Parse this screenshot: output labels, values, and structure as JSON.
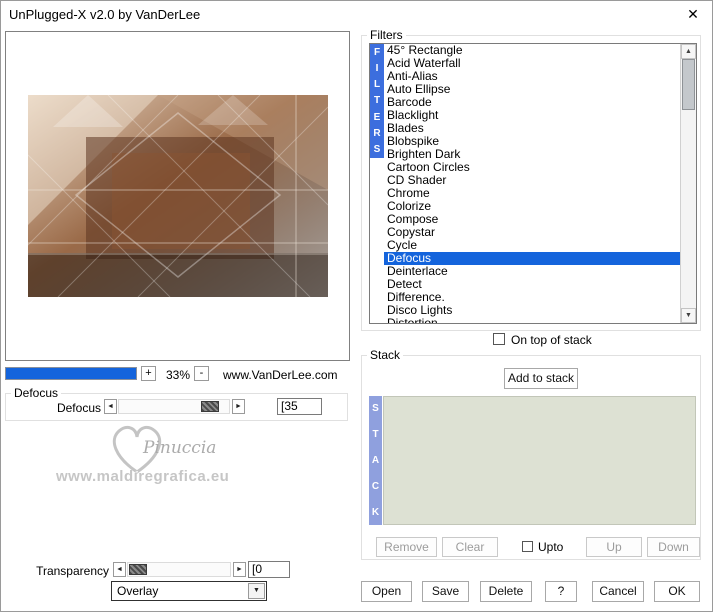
{
  "window": {
    "title": "UnPlugged-X v2.0 by VanDerLee",
    "close_glyph": "✕"
  },
  "preview": {
    "zoom_in": "+",
    "zoom_out": "-",
    "zoom_level": "33%",
    "website": "www.VanDerLee.com"
  },
  "defocus": {
    "group_label": "Defocus",
    "slider_label": "Defocus",
    "value": "[35"
  },
  "transparency": {
    "label": "Transparency",
    "value": "[0"
  },
  "blend_mode": {
    "selected": "Overlay"
  },
  "filters": {
    "group_label": "Filters",
    "vertical_label": "FILTERS",
    "selected_index": 16,
    "items": [
      "45° Rectangle",
      "Acid Waterfall",
      "Anti-Alias",
      "Auto Ellipse",
      "Barcode",
      "Blacklight",
      "Blades",
      "Blobspike",
      "Brighten Dark",
      "Cartoon Circles",
      "CD Shader",
      "Chrome",
      "Colorize",
      "Compose",
      "Copystar",
      "Cycle",
      "Defocus",
      "Deinterlace",
      "Detect",
      "Difference.",
      "Disco Lights",
      "Distortion"
    ],
    "on_top_label": "On top of stack"
  },
  "stack": {
    "group_label": "Stack",
    "vertical_label": "STACK",
    "add_button": "Add to stack",
    "remove_button": "Remove",
    "clear_button": "Clear",
    "upto_label": "Upto",
    "up_button": "Up",
    "down_button": "Down"
  },
  "footer": {
    "open": "Open",
    "save": "Save",
    "delete": "Delete",
    "help": "?",
    "cancel": "Cancel",
    "ok": "OK"
  },
  "watermark": {
    "name": "Pinuccia",
    "site": "www.maldiregrafica.eu"
  },
  "glyphs": {
    "left": "◄",
    "right": "►",
    "up": "▲",
    "down": "▼",
    "dropdown": "▼"
  },
  "colors": {
    "highlight": "#1464dc",
    "filters_strip": "#3c6ede",
    "stack_strip": "#8fa0de",
    "stack_bg": "#dde1d3"
  }
}
